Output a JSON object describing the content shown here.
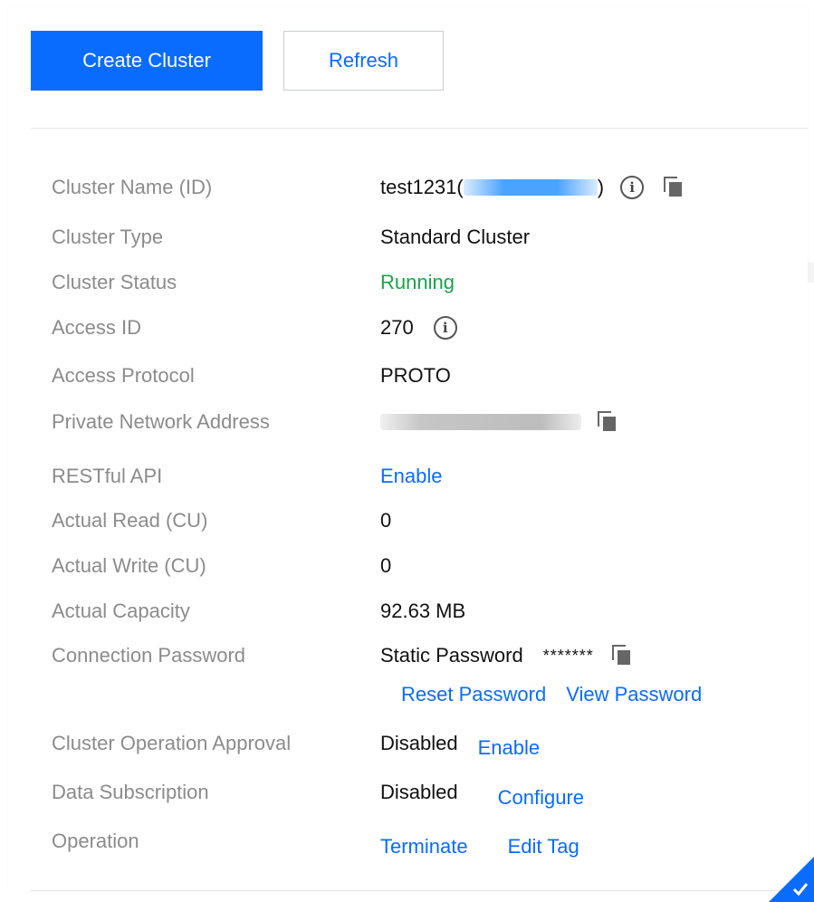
{
  "toolbar": {
    "create_label": "Create Cluster",
    "refresh_label": "Refresh"
  },
  "details": {
    "cluster_name": {
      "label": "Cluster Name (ID)",
      "name": "test1231(",
      "close": ")"
    },
    "cluster_type": {
      "label": "Cluster Type",
      "value": "Standard Cluster"
    },
    "cluster_status": {
      "label": "Cluster Status",
      "value": "Running",
      "color": "#1aa34a"
    },
    "access_id": {
      "label": "Access ID",
      "value": "270"
    },
    "access_protocol": {
      "label": "Access Protocol",
      "value": "PROTO"
    },
    "private_address": {
      "label": "Private Network Address"
    },
    "restful_api": {
      "label": "RESTful API",
      "action": "Enable"
    },
    "actual_read": {
      "label": "Actual Read (CU)",
      "value": "0"
    },
    "actual_write": {
      "label": "Actual Write (CU)",
      "value": "0"
    },
    "actual_capacity": {
      "label": "Actual Capacity",
      "value": "92.63 MB"
    },
    "connection_password": {
      "label": "Connection Password",
      "type": "Static Password",
      "masked": "*******",
      "reset": "Reset Password",
      "view": "View Password"
    },
    "approval": {
      "label": "Cluster Operation Approval",
      "value": "Disabled",
      "action": "Enable"
    },
    "subscription": {
      "label": "Data Subscription",
      "value": "Disabled",
      "action": "Configure"
    },
    "operation": {
      "label": "Operation",
      "terminate": "Terminate",
      "edit_tag": "Edit Tag"
    }
  },
  "colors": {
    "primary": "#0a6bff",
    "label": "#8b8b8b",
    "success": "#1aa34a"
  }
}
